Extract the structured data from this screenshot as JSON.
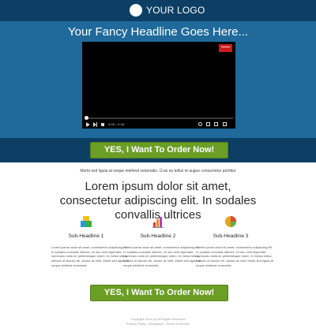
{
  "header": {
    "logo_text": "YOUR LOGO"
  },
  "hero": {
    "headline": "Your Fancy Headline Goes Here..."
  },
  "video": {
    "time_label": "0:00 / 2:18"
  },
  "cta": {
    "label_top": "YES, I Want To Order Now!",
    "label_bottom": "YES, I Want To Order Now!"
  },
  "content": {
    "subline": "Morbi sed ligula at neque eleifend venenatis. Cras eu tellus et augue consectetur porttitor",
    "headline": "Lorem ipsum dolor sit amet, consectetur adipiscing elit. In sodales convallis ultrices",
    "features": [
      {
        "title": "Sub-Headline 1",
        "body": "Lorem ipsum dolor sit amet, consectetur adipiscing elit. In sodales convallis ultrices. Ut non velit imperdiet, commodo nulla at, pellentesque lorem. In metus tellus, ultrices ut dictum vel, auctor ac velit. Morbi sed ligula at neque eleifend venenatis."
      },
      {
        "title": "Sub-Headline 2",
        "body": "Lorem ipsum dolor sit amet, consectetur adipiscing elit. In sodales convallis ultrices. Ut non velit imperdiet, commodo nulla at, pellentesque lorem. In metus tellus, ultrices ut dictum vel, auctor ac velit. Morbi sed ligula at neque eleifend venenatis."
      },
      {
        "title": "Sub-Headline 3",
        "body": "Lorem ipsum dolor sit amet, consectetur adipiscing elit. In sodales convallis ultrices. Ut non velit imperdiet, commodo nulla at, pellentesque lorem. In metus tellus, ultrices ut dictum vel, auctor ac velit. Morbi sed ligula at neque eleifend venenatis."
      }
    ]
  },
  "footer": {
    "copyright": "Copyright 2014 (c) All Rights Reserved",
    "links": [
      "Privacy Policy",
      "Disclaimer",
      "Terms of Service"
    ],
    "separator": " - "
  },
  "colors": {
    "header_bg": "#0c3f63",
    "hero_bg": "#1f6a9a",
    "cta_green": "#6b9e25"
  }
}
